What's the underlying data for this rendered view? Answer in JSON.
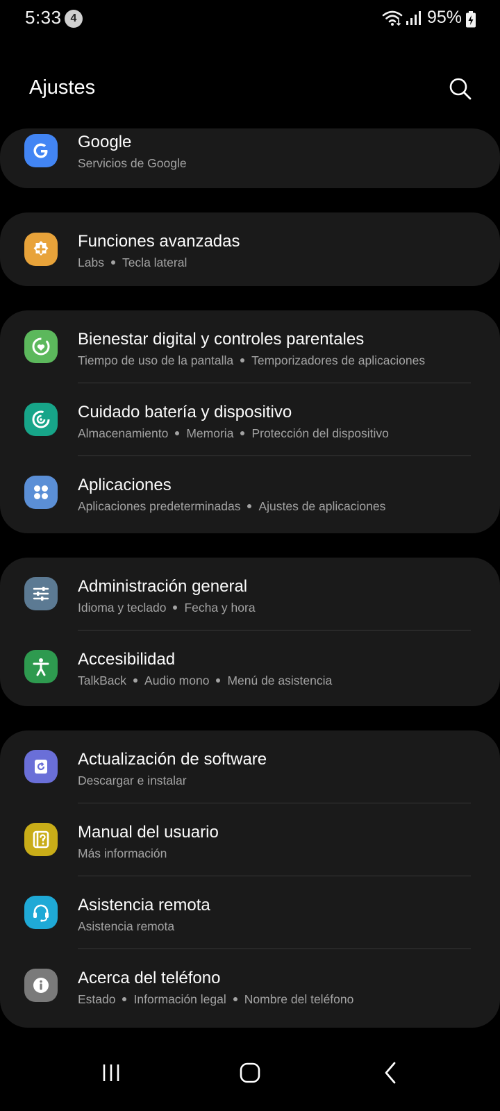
{
  "status_bar": {
    "time": "5:33",
    "notification_count": "4",
    "battery_percent": "95%",
    "icons": [
      "wifi-icon",
      "signal-icon",
      "battery-charging-icon"
    ]
  },
  "header": {
    "title": "Ajustes",
    "search_icon": "search-icon"
  },
  "settings": {
    "google": {
      "title": "Google",
      "subtitles": [
        "Servicios de Google"
      ],
      "icon": "google-icon",
      "color": "#4285f4"
    },
    "advanced": {
      "title": "Funciones avanzadas",
      "subtitles": [
        "Labs",
        "Tecla lateral"
      ],
      "icon": "advanced-features-icon",
      "color": "#e8a33a"
    },
    "wellbeing": {
      "title": "Bienestar digital y controles parentales",
      "subtitles": [
        "Tiempo de uso de la pantalla",
        "Temporizadores de aplicaciones"
      ],
      "icon": "digital-wellbeing-icon",
      "color": "#5cb85c"
    },
    "battery": {
      "title": "Cuidado batería y dispositivo",
      "subtitles": [
        "Almacenamiento",
        "Memoria",
        "Protección del dispositivo"
      ],
      "icon": "device-care-icon",
      "color": "#17a589"
    },
    "apps": {
      "title": "Aplicaciones",
      "subtitles": [
        "Aplicaciones predeterminadas",
        "Ajustes de aplicaciones"
      ],
      "icon": "apps-icon",
      "color": "#5b8fd6"
    },
    "general": {
      "title": "Administración general",
      "subtitles": [
        "Idioma y teclado",
        "Fecha y hora"
      ],
      "icon": "general-management-icon",
      "color": "#5c7a93"
    },
    "accessibility": {
      "title": "Accesibilidad",
      "subtitles": [
        "TalkBack",
        "Audio mono",
        "Menú de asistencia"
      ],
      "icon": "accessibility-icon",
      "color": "#2e9a4f"
    },
    "update": {
      "title": "Actualización de software",
      "subtitles": [
        "Descargar e instalar"
      ],
      "icon": "software-update-icon",
      "color": "#6a6fd8"
    },
    "manual": {
      "title": "Manual del usuario",
      "subtitles": [
        "Más información"
      ],
      "icon": "user-manual-icon",
      "color": "#c9ad18"
    },
    "remote": {
      "title": "Asistencia remota",
      "subtitles": [
        "Asistencia remota"
      ],
      "icon": "remote-support-icon",
      "color": "#1fa9d6"
    },
    "about": {
      "title": "Acerca del teléfono",
      "subtitles": [
        "Estado",
        "Información legal",
        "Nombre del teléfono"
      ],
      "icon": "about-phone-icon",
      "color": "#7a7a7a"
    }
  },
  "nav_bar": {
    "buttons": [
      "recent-apps-icon",
      "home-icon",
      "back-icon"
    ]
  }
}
